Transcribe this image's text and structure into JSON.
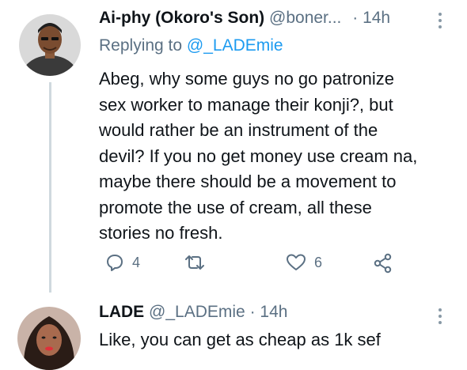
{
  "tweet1": {
    "name": "Ai-phy (Okoro's Son)",
    "handle": "@boner...",
    "dot": "·",
    "time": "14h",
    "replying_prefix": "Replying to",
    "replying_to": "@_LADEmie",
    "body_lines": [
      "Abeg, why some guys no go patronize",
      "sex worker to manage their konji?, but",
      "would rather be an instrument of the",
      "devil? If you no get money use cream na,",
      "maybe there should be a movement to",
      "promote the use of cream, all these",
      "stories no fresh."
    ],
    "actions": {
      "replies": "4",
      "retweets": "",
      "likes": "6"
    }
  },
  "tweet2": {
    "name": "LADE",
    "handle": "@_LADEmie",
    "dot": "·",
    "time": "14h",
    "body": "Like, you can get as cheap as 1k sef"
  },
  "icons": {
    "reply": "reply-icon",
    "retweet": "retweet-icon",
    "like": "heart-icon",
    "share": "share-icon",
    "more": "more-vertical-icon"
  },
  "colors": {
    "accent": "#1d9bf0",
    "secondary_text": "#5b7083",
    "thread_line": "#cfd9de"
  }
}
